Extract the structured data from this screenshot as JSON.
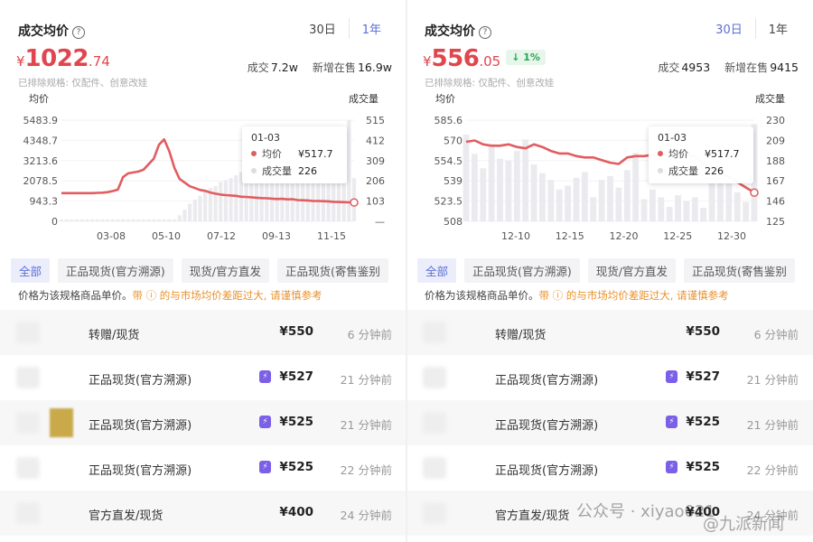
{
  "panels": [
    {
      "title": "成交均价",
      "range_tabs": [
        "30日",
        "1年"
      ],
      "active_range": 1,
      "price": {
        "currency": "¥",
        "int": "1022",
        "dec": ".74",
        "change": ""
      },
      "stats": {
        "deal_label": "成交",
        "deal_value": "7.2w",
        "new_label": "新增在售",
        "new_value": "16.9w"
      },
      "note": "已排除规格: 仅配件、创意改娃",
      "left_axis_title": "均价",
      "right_axis_title": "成交量",
      "tooltip": {
        "date": "01-03",
        "price_label": "均价",
        "price_value": "¥517.7",
        "volume_label": "成交量",
        "volume_value": "226"
      },
      "filters": [
        "全部",
        "正品现货(官方溯源)",
        "现货/官方直发",
        "正品现货(寄售鉴别"
      ],
      "disclaimer": {
        "prefix": "价格为该规格商品单价。",
        "warn": "带 ⓘ 的与市场均价差距过大, 请谨慎参考"
      },
      "rows": [
        {
          "title": "转赠/现货",
          "price": "¥550",
          "badge": false,
          "time": "6 分钟前",
          "thumb": "none"
        },
        {
          "title": "正品现货(官方溯源)",
          "price": "¥527",
          "badge": true,
          "time": "21 分钟前",
          "thumb": "none"
        },
        {
          "title": "正品现货(官方溯源)",
          "price": "¥525",
          "badge": true,
          "time": "21 分钟前",
          "thumb": "gold"
        },
        {
          "title": "正品现货(官方溯源)",
          "price": "¥525",
          "badge": true,
          "time": "22 分钟前",
          "thumb": "none"
        },
        {
          "title": "官方直发/现货",
          "price": "¥400",
          "badge": false,
          "time": "24 分钟前",
          "thumb": "none"
        }
      ]
    },
    {
      "title": "成交均价",
      "range_tabs": [
        "30日",
        "1年"
      ],
      "active_range": 0,
      "price": {
        "currency": "¥",
        "int": "556",
        "dec": ".05",
        "change": "↓ 1%"
      },
      "stats": {
        "deal_label": "成交",
        "deal_value": "4953",
        "new_label": "新增在售",
        "new_value": "9415"
      },
      "note": "已排除规格: 仅配件、创意改娃",
      "left_axis_title": "均价",
      "right_axis_title": "成交量",
      "tooltip": {
        "date": "01-03",
        "price_label": "均价",
        "price_value": "¥517.7",
        "volume_label": "成交量",
        "volume_value": "226"
      },
      "filters": [
        "全部",
        "正品现货(官方溯源)",
        "现货/官方直发",
        "正品现货(寄售鉴别"
      ],
      "disclaimer": {
        "prefix": "价格为该规格商品单价。",
        "warn": "带 ⓘ 的与市场均价差距过大, 请谨慎参考"
      },
      "rows": [
        {
          "title": "转赠/现货",
          "price": "¥550",
          "badge": false,
          "time": "6 分钟前",
          "thumb": "none"
        },
        {
          "title": "正品现货(官方溯源)",
          "price": "¥527",
          "badge": true,
          "time": "21 分钟前",
          "thumb": "none"
        },
        {
          "title": "正品现货(官方溯源)",
          "price": "¥525",
          "badge": true,
          "time": "21 分钟前",
          "thumb": "none"
        },
        {
          "title": "正品现货(官方溯源)",
          "price": "¥525",
          "badge": true,
          "time": "22 分钟前",
          "thumb": "none"
        },
        {
          "title": "官方直发/现货",
          "price": "¥400",
          "badge": false,
          "time": "24 分钟前",
          "thumb": "none"
        }
      ]
    }
  ],
  "watermarks": {
    "wechat": "公众号 · xiyao021",
    "weibo": "@九派新闻"
  },
  "colors": {
    "price_line": "#e25c60",
    "volume_bar": "#ebebef",
    "accent": "#5a6fd6",
    "price_red": "#e0464d",
    "warn": "#e8922e",
    "down_green": "#2aa557"
  },
  "chart_data": [
    {
      "type": "line",
      "title": "成交均价",
      "ylabel": "均价",
      "y2label": "成交量",
      "x_ticks": [
        "03-08",
        "05-10",
        "07-12",
        "09-13",
        "11-15"
      ],
      "y_ticks": [
        "5483.9",
        "4348.7",
        "3213.6",
        "2078.5",
        "943.3",
        "0"
      ],
      "y2_ticks": [
        "515",
        "412",
        "309",
        "206",
        "103",
        "—"
      ],
      "ylim": [
        0,
        5483.9
      ],
      "y2lim": [
        0,
        515
      ],
      "series": [
        {
          "values": [
            1530,
            1530,
            1530,
            1530,
            1530,
            1530,
            1530,
            1540,
            1550,
            1580,
            1640,
            1720,
            2400,
            2600,
            2650,
            2700,
            2800,
            3100,
            3400,
            4150,
            4440,
            3800,
            2900,
            2300,
            2100,
            1900,
            1800,
            1700,
            1650,
            1560,
            1500,
            1450,
            1420,
            1400,
            1380,
            1330,
            1320,
            1300,
            1280,
            1260,
            1250,
            1230,
            1210,
            1220,
            1190,
            1200,
            1150,
            1140,
            1130,
            1100,
            1100,
            1090,
            1080,
            1060,
            1050,
            1040,
            1030,
            1022
          ]
        },
        {
          "values": [
            10,
            10,
            10,
            10,
            10,
            10,
            10,
            10,
            10,
            10,
            10,
            10,
            10,
            10,
            10,
            10,
            10,
            10,
            10,
            10,
            10,
            10,
            10,
            30,
            60,
            90,
            110,
            130,
            150,
            170,
            180,
            200,
            210,
            220,
            235,
            250,
            265,
            270,
            280,
            290,
            300,
            310,
            320,
            325,
            330,
            340,
            345,
            350,
            355,
            360,
            370,
            380,
            390,
            400,
            410,
            470,
            515,
            220
          ]
        }
      ]
    },
    {
      "type": "line",
      "title": "成交均价",
      "ylabel": "均价",
      "y2label": "成交量",
      "x_ticks": [
        "12-10",
        "12-15",
        "12-20",
        "12-25",
        "12-30"
      ],
      "y_ticks": [
        "585.6",
        "570",
        "554.5",
        "539",
        "523.5",
        "508"
      ],
      "y2_ticks": [
        "230",
        "209",
        "188",
        "167",
        "146",
        "125"
      ],
      "ylim": [
        508,
        585.6
      ],
      "y2lim": [
        125,
        230
      ],
      "series": [
        {
          "values": [
            569,
            570,
            567,
            566,
            566,
            567,
            565,
            564,
            567,
            565,
            562,
            560,
            560,
            558,
            557,
            557,
            555,
            553,
            552,
            557,
            558,
            558,
            559,
            559,
            560,
            560,
            559,
            558,
            552,
            548,
            545,
            542,
            538,
            534,
            530
          ]
        },
        {
          "values": [
            215,
            195,
            180,
            205,
            190,
            188,
            198,
            210,
            184,
            175,
            168,
            158,
            162,
            170,
            176,
            150,
            168,
            172,
            160,
            178,
            196,
            148,
            158,
            150,
            140,
            152,
            146,
            150,
            139,
            212,
            165,
            180,
            155,
            145,
            226
          ]
        }
      ]
    }
  ]
}
